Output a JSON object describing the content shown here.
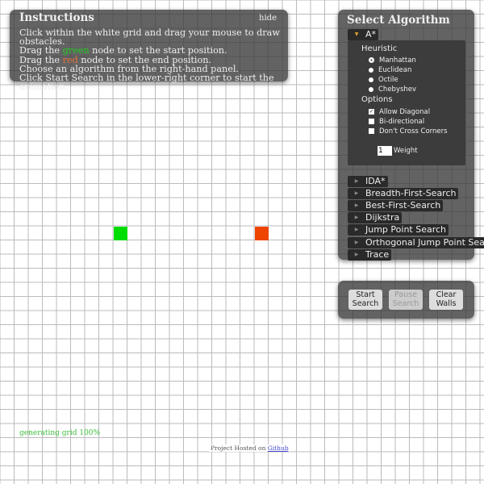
{
  "instructions": {
    "title": "Instructions",
    "hide": "hide",
    "line1": "Click within the white grid and drag your mouse to draw obstacles.",
    "line2_pre": "Drag the ",
    "line2_word": "green",
    "line2_post": " node to set the start position.",
    "line3_pre": "Drag the ",
    "line3_word": "red",
    "line3_post": " node to set the end position.",
    "line4": "Choose an algorithm from the right-hand panel.",
    "line5": "Click Start Search in the lower-right corner to start the animation."
  },
  "algorithm_panel": {
    "title": "Select Algorithm",
    "astar": {
      "label": "A*",
      "expanded": true,
      "heuristic_label": "Heuristic",
      "heuristics": [
        "Manhattan",
        "Euclidean",
        "Octile",
        "Chebyshev"
      ],
      "selected_heuristic": "Manhattan",
      "options_label": "Options",
      "options": [
        {
          "label": "Allow Diagonal",
          "checked": true
        },
        {
          "label": "Bi-directional",
          "checked": false
        },
        {
          "label": "Don't Cross Corners",
          "checked": false
        }
      ],
      "weight_value": "1",
      "weight_label": "Weight"
    },
    "others": [
      "IDA*",
      "Breadth-First-Search",
      "Best-First-Search",
      "Dijkstra",
      "Jump Point Search",
      "Orthogonal Jump Point Search",
      "Trace"
    ]
  },
  "controls": {
    "start": "Start Search",
    "pause": "Pause Search",
    "clear": "Clear Walls",
    "pause_disabled": true
  },
  "grid": {
    "start_node_color": "#00dd00",
    "end_node_color": "#ee4400",
    "start_cell": [
      8,
      16
    ],
    "end_cell": [
      18,
      16
    ]
  },
  "status": "generating grid 100%",
  "footer": {
    "text": "Project Hosted on ",
    "link": "Github"
  }
}
